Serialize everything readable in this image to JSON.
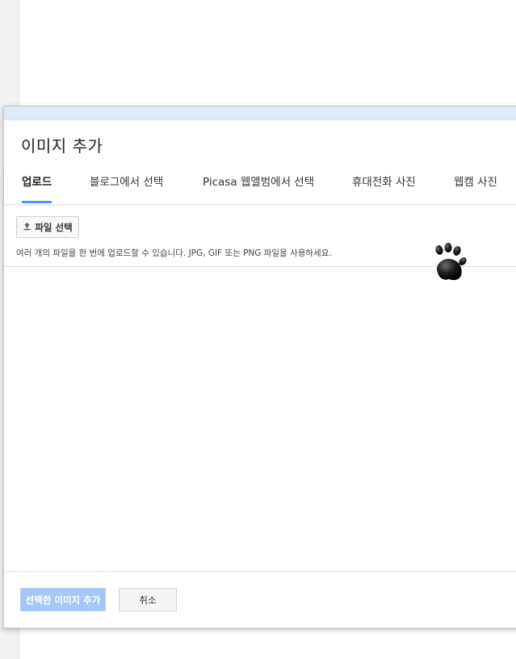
{
  "dialog": {
    "title": "이미지 추가"
  },
  "tabs": [
    {
      "label": "업로드",
      "active": true
    },
    {
      "label": "블로그에서 선택",
      "active": false
    },
    {
      "label": "Picasa 웹앨범에서 선택",
      "active": false
    },
    {
      "label": "휴대전화 사진",
      "active": false
    },
    {
      "label": "웹캠 사진",
      "active": false
    }
  ],
  "upload": {
    "file_button_label": "파일 선택",
    "file_button_icon": "upload-icon",
    "help_text": "여러 개의 파일을 한 번에 업로드할 수 있습니다. JPG, GIF 또는 PNG 파일을 사용하세요."
  },
  "footer": {
    "add_label": "선택한 이미지 추가",
    "cancel_label": "취소"
  },
  "overlay": {
    "icon": "paw-icon"
  },
  "colors": {
    "accent": "#4d90fe",
    "add_button_disabled": "#a6c8f7",
    "topbar": "#dfeaf9"
  }
}
